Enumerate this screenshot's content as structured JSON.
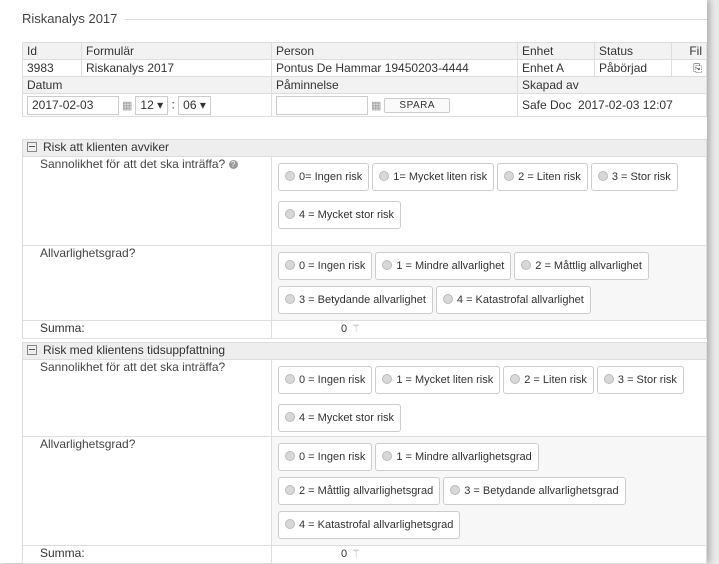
{
  "title": "Riskanalys 2017",
  "info": {
    "headers": [
      "Id",
      "Formulär",
      "Person",
      "Enhet",
      "Status",
      "Fil"
    ],
    "id": "3983",
    "form": "Riskanalys 2017",
    "person": "Pontus De Hammar 19450203-4444",
    "unit": "Enhet A",
    "status": "Påbörjad",
    "file_icon": "export-icon",
    "headers2": [
      "Datum",
      "Påminnelse",
      "Skapad av"
    ],
    "date": "2017-02-03",
    "hour": "12",
    "minute": "06",
    "reminder": "",
    "save_label": "SPARA",
    "created_by": "Safe Doc",
    "created_at": "2017-02-03 12:07"
  },
  "section1": {
    "title": "Risk att klienten avviker",
    "q1": "Sannolikhet för att det ska inträffa?",
    "q1_options": [
      "0= Ingen risk",
      "1= Mycket liten risk",
      "2 = Liten risk",
      "3 = Stor risk",
      "4 = Mycket stor risk"
    ],
    "q2": "Allvarlighetsgrad?",
    "q2_options": [
      "0 = Ingen risk",
      "1 = Mindre allvarlighet",
      "2 = Måttlig allvarlighet",
      "3 = Betydande allvarlighet",
      "4 = Katastrofal allvarlighet"
    ],
    "sum_label": "Summa:",
    "sum_value": "0"
  },
  "section2": {
    "title": "Risk med klientens tidsuppfattning",
    "q1": "Sannolikhet för att det ska inträffa?",
    "q1_options": [
      "0 = Ingen risk",
      "1 = Mycket liten risk",
      "2 = Liten risk",
      "3 = Stor risk",
      "4 = Mycket stor risk"
    ],
    "q2": "Allvarlighetsgrad?",
    "q2_options": [
      "0 = Ingen risk",
      "1 = Mindre allvarlighetsgrad",
      "2 = Måttlig allvarlighetsgrad",
      "3 = Betydande allvarlighetsgrad",
      "4 = Katastrofal allvarlighetsgrad"
    ],
    "sum_label": "Summa:",
    "sum_value": "0"
  }
}
